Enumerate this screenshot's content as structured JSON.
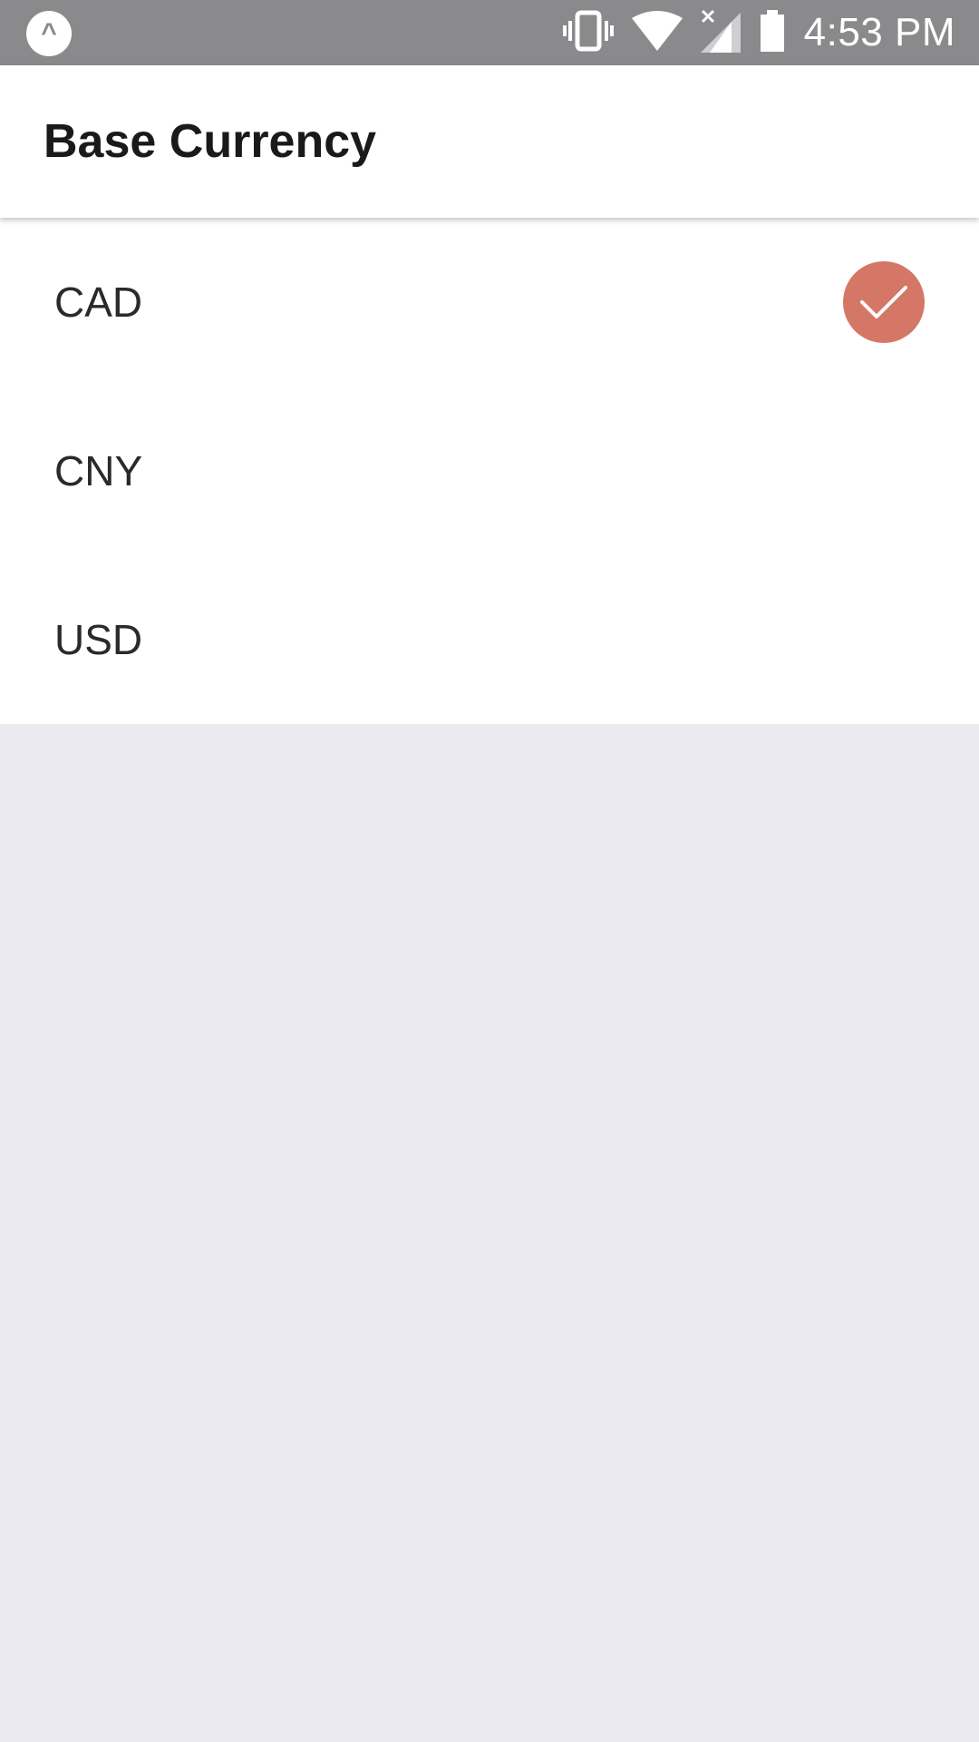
{
  "status_bar": {
    "time": "4:53 PM",
    "app_icon": "expo-icon",
    "icons": [
      "vibrate-icon",
      "wifi-icon",
      "signal-no-service-icon",
      "battery-icon"
    ]
  },
  "header": {
    "title": "Base Currency"
  },
  "currencies": [
    {
      "label": "CAD",
      "selected": true
    },
    {
      "label": "CNY",
      "selected": false
    },
    {
      "label": "USD",
      "selected": false
    }
  ],
  "colors": {
    "status_bar": "#8a8a8c",
    "accent": "#d57766",
    "background": "#e9e9ef"
  }
}
